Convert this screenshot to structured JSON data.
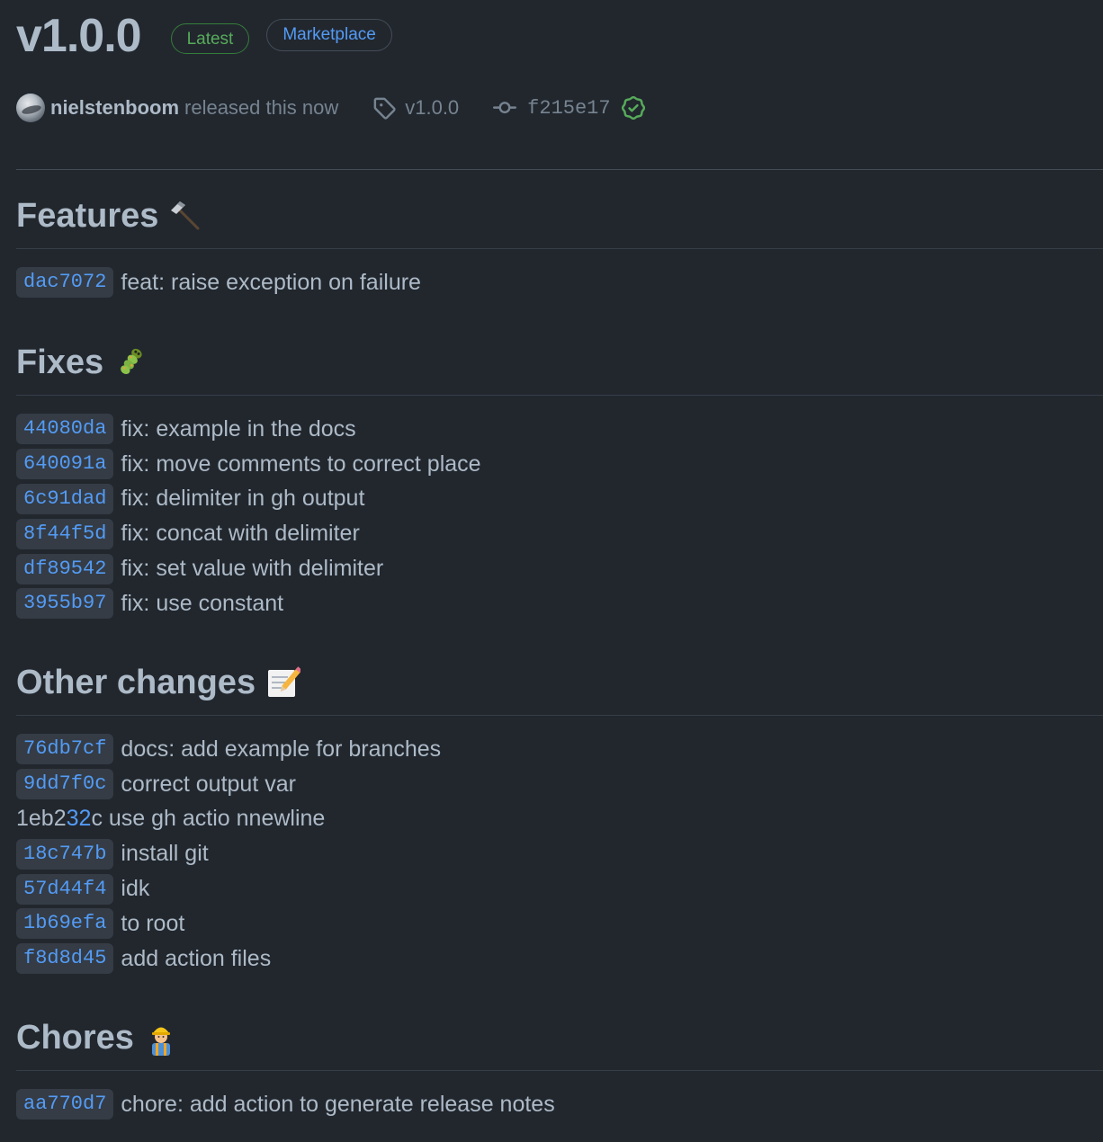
{
  "release": {
    "title": "v1.0.0",
    "latest_badge": "Latest",
    "marketplace_badge": "Marketplace",
    "author": "nielstenboom",
    "released_text": "released this now",
    "tag": "v1.0.0",
    "commit": "f215e17"
  },
  "sections": {
    "features": {
      "title": "Features",
      "emoji": "⛏",
      "items": [
        {
          "sha": "dac7072",
          "message": "feat: raise exception on failure"
        }
      ]
    },
    "fixes": {
      "title": "Fixes",
      "emoji": "🐛",
      "items": [
        {
          "sha": "44080da",
          "message": "fix: example in the docs"
        },
        {
          "sha": "640091a",
          "message": "fix: move comments to correct place"
        },
        {
          "sha": "6c91dad",
          "message": "fix: delimiter in gh output"
        },
        {
          "sha": "8f44f5d",
          "message": "fix: concat with delimiter"
        },
        {
          "sha": "df89542",
          "message": "fix: set value with delimiter"
        },
        {
          "sha": "3955b97",
          "message": "fix: use constant"
        }
      ]
    },
    "other": {
      "title": "Other changes",
      "emoji": "📝",
      "items": [
        {
          "sha": "76db7cf",
          "message": "docs: add example for branches"
        },
        {
          "sha": "9dd7f0c",
          "message": "correct output var"
        },
        {
          "plain_pre": "1eb2",
          "plain_link": "32",
          "plain_post": "c use gh actio nnewline"
        },
        {
          "sha": "18c747b",
          "message": "install git"
        },
        {
          "sha": "57d44f4",
          "message": "idk"
        },
        {
          "sha": "1b69efa",
          "message": "to root"
        },
        {
          "sha": "f8d8d45",
          "message": "add action files"
        }
      ]
    },
    "chores": {
      "title": "Chores",
      "emoji": "👷",
      "items": [
        {
          "sha": "aa770d7",
          "message": "chore: add action to generate release notes"
        }
      ]
    }
  },
  "colors": {
    "background": "#22272e",
    "text": "#adbac7",
    "muted": "#768390",
    "link": "#539bf5",
    "success": "#57ab5a"
  }
}
